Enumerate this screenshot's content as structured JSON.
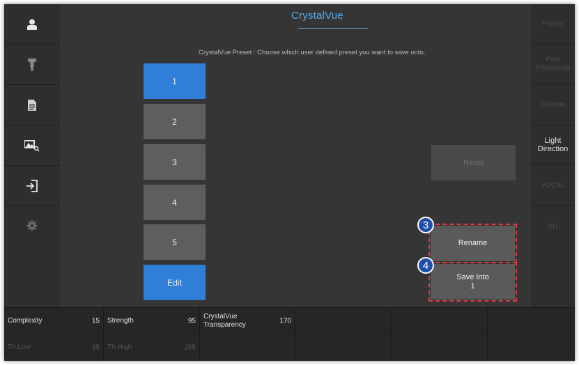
{
  "app": {
    "title": "CrystalVue",
    "description": "CrystalVue Preset : Choose which user defined preset you want to save onto."
  },
  "left_sidebar": {
    "icons": [
      "user-icon",
      "probe-icon",
      "document-icon",
      "image-search-icon",
      "exit-icon",
      "settings-icon"
    ]
  },
  "right_sidebar": {
    "items": [
      {
        "label": "Preset"
      },
      {
        "label": "Post Processing"
      },
      {
        "label": "Chroma"
      },
      {
        "label": "Light Direction"
      },
      {
        "label": "VOCAL"
      },
      {
        "label": "SD"
      }
    ]
  },
  "presets": {
    "buttons": [
      {
        "label": "1"
      },
      {
        "label": "2"
      },
      {
        "label": "3"
      },
      {
        "label": "4"
      },
      {
        "label": "5"
      }
    ],
    "edit_label": "Edit"
  },
  "actions": {
    "reset_label": "Reset",
    "rename_label": "Rename",
    "save_into_label": "Save Into",
    "save_into_value": "1",
    "badge_rename": "3",
    "badge_save": "4"
  },
  "params": {
    "row1": [
      {
        "label": "Complexity",
        "value": "15"
      },
      {
        "label": "Strength",
        "value": "95"
      },
      {
        "label": "CrystalVue Transparency",
        "value": "170"
      }
    ],
    "row2": [
      {
        "label": "Th.Low",
        "value": "45"
      },
      {
        "label": "Th.High",
        "value": "255"
      }
    ]
  },
  "colors": {
    "accent": "#2f7fd8",
    "title": "#5aa9e6",
    "highlight": "#e63946",
    "badge": "#1f4fa8"
  }
}
